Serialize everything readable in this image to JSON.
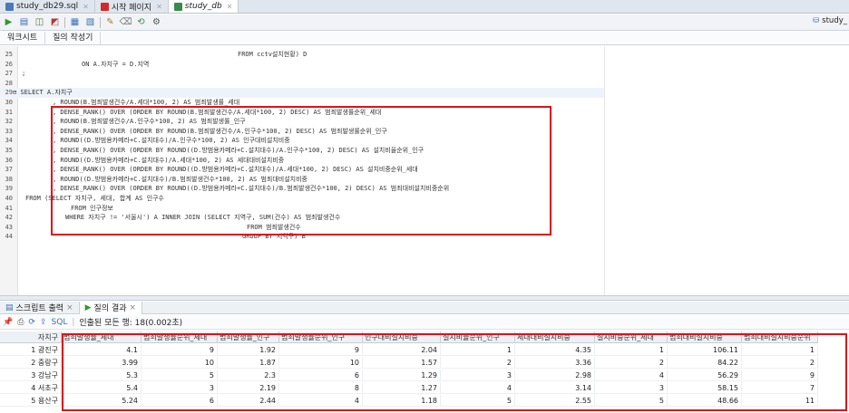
{
  "tabs": [
    {
      "label": "study_db29.sql",
      "color": "#4a7ab8"
    },
    {
      "label": "시작 페이지",
      "color": "#d42a2a"
    },
    {
      "label": "study_db",
      "color": "#3a8a4a"
    }
  ],
  "connection_label": "study_",
  "subtabs": [
    "워크시트",
    "질의 작성기"
  ],
  "code": [
    {
      "ln": "25",
      "indent": 262,
      "text": "FROM cctv설치현황) D"
    },
    {
      "ln": "26",
      "indent": 90,
      "text": "ON A.자치구 = D.지역"
    },
    {
      "ln": "27",
      "indent": 24,
      "text": ";"
    },
    {
      "ln": "28",
      "indent": 24,
      "text": ""
    },
    {
      "ln": "29",
      "indent": 14,
      "text": "⊟ SELECT A.자치구"
    },
    {
      "ln": "30",
      "indent": 58,
      "text": ", ROUND(B.범죄발생건수/A.세대*100, 2) AS 범죄발생률_세대"
    },
    {
      "ln": "31",
      "indent": 58,
      "text": ", DENSE_RANK() OVER (ORDER BY ROUND(B.범죄발생건수/A.세대*100, 2) DESC) AS 범죄발생률순위_세대"
    },
    {
      "ln": "32",
      "indent": 58,
      "text": ", ROUND(B.범죄발생건수/A.인구수*100, 2) AS 범죄발생률_인구"
    },
    {
      "ln": "33",
      "indent": 58,
      "text": ", DENSE_RANK() OVER (ORDER BY ROUND(B.범죄발생건수/A.인구수*100, 2) DESC) AS 범죄발생률순위_인구"
    },
    {
      "ln": "34",
      "indent": 58,
      "text": ", ROUND((D.방범용카메라+C.설치대수)/A.인구수*100, 2) AS 인구대비설치비중"
    },
    {
      "ln": "35",
      "indent": 58,
      "text": ", DENSE_RANK() OVER (ORDER BY ROUND((D.방범용카메라+C.설치대수)/A.인구수*100, 2) DESC) AS 설치비율순위_인구"
    },
    {
      "ln": "36",
      "indent": 58,
      "text": ", ROUND((D.방범용카메라+C.설치대수)/A.세대*100, 2) AS 세대대비설치비중"
    },
    {
      "ln": "37",
      "indent": 58,
      "text": ", DENSE_RANK() OVER (ORDER BY ROUND((D.방범용카메라+C.설치대수)/A.세대*100, 2) DESC) AS 설치비중순위_세대"
    },
    {
      "ln": "38",
      "indent": 58,
      "text": ", ROUND((D.방범용카메라+C.설치대수)/B.범죄발생건수*100, 2) AS 범죄대비설치비중"
    },
    {
      "ln": "39",
      "indent": 58,
      "text": ", DENSE_RANK() OVER (ORDER BY ROUND((D.방범용카메라+C.설치대수)/B.범죄발생건수*100, 2) DESC) AS 범죄대비설치비중순위"
    },
    {
      "ln": "40",
      "indent": 28,
      "text": "FROM (SELECT 자치구, 세대, 합계 AS 인구수"
    },
    {
      "ln": "41",
      "indent": 78,
      "text": "FROM 인구정보"
    },
    {
      "ln": "42",
      "indent": 72,
      "text": "WHERE 자치구 != '서울시') A INNER JOIN (SELECT 지역구, SUM(건수) AS 범죄발생건수"
    },
    {
      "ln": "43",
      "indent": 272,
      "text": "FROM 범죄발생건수"
    },
    {
      "ln": "44",
      "indent": 267,
      "text": "GROUP BY 지역구) B"
    }
  ],
  "output_tabs": [
    "스크립트 출력",
    "질의 결과"
  ],
  "result_toolbar": {
    "sql_label": "SQL",
    "status": "인출된 모든 행: 18(0.002초)"
  },
  "columns": [
    "자치구",
    "범죄발생률_세대",
    "범죄발생률순위_세대",
    "범죄발생률_인구",
    "범죄발생률순위_인구",
    "인구대비설치비중",
    "설치비율순위_인구",
    "세대대비설치비중",
    "설치비중순위_세대",
    "범죄대비설치비중",
    "범죄대비설치비중순위"
  ],
  "rows": [
    [
      "1",
      "광진구",
      "4.1",
      "9",
      "1.92",
      "9",
      "2.04",
      "1",
      "4.35",
      "1",
      "106.11",
      "1"
    ],
    [
      "2",
      "중랑구",
      "3.99",
      "10",
      "1.87",
      "10",
      "1.57",
      "2",
      "3.36",
      "2",
      "84.22",
      "2"
    ],
    [
      "3",
      "강남구",
      "5.3",
      "5",
      "2.3",
      "6",
      "1.29",
      "3",
      "2.98",
      "4",
      "56.29",
      "9"
    ],
    [
      "4",
      "서초구",
      "5.4",
      "3",
      "2.19",
      "8",
      "1.27",
      "4",
      "3.14",
      "3",
      "58.15",
      "7"
    ],
    [
      "5",
      "용산구",
      "5.24",
      "6",
      "2.44",
      "4",
      "1.18",
      "5",
      "2.55",
      "5",
      "48.66",
      "11"
    ]
  ]
}
